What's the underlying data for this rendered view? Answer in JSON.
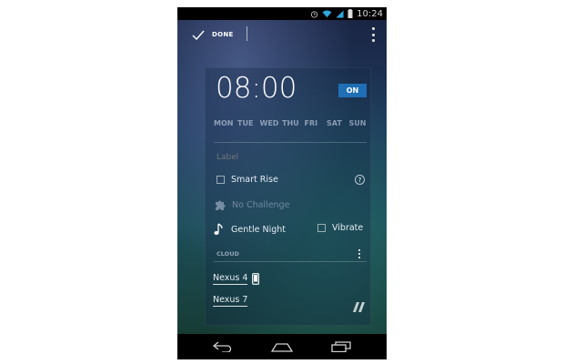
{
  "status_bar": {
    "time": "10:24",
    "icons": [
      "alarm-icon",
      "wifi-icon",
      "signal-icon",
      "battery-icon"
    ]
  },
  "action_bar": {
    "done_label": "DONE",
    "icons": [
      "checkmark-icon",
      "overflow-menu-icon"
    ]
  },
  "alarm": {
    "time": "08:00",
    "toggle_label": "ON",
    "toggle_color": "#1f6fb6",
    "days": [
      "MON",
      "TUE",
      "WED",
      "THU",
      "FRI",
      "SAT",
      "SUN"
    ],
    "label_placeholder": "Label",
    "smart_rise": {
      "label": "Smart Rise",
      "checked": false,
      "help_icon": "?"
    },
    "challenge": {
      "label": "No Challenge",
      "icon": "puzzle-icon"
    },
    "ringtone": {
      "label": "Gentle Night",
      "icon": "music-note-icon"
    },
    "vibrate": {
      "label": "Vibrate",
      "checked": false
    }
  },
  "cloud": {
    "header": "CLOUD",
    "devices": [
      {
        "name": "Nexus 4",
        "icon": "phone-icon"
      },
      {
        "name": "Nexus 7"
      }
    ]
  },
  "nav_bar": {
    "icons": [
      "back-icon",
      "home-icon",
      "recents-icon"
    ]
  }
}
